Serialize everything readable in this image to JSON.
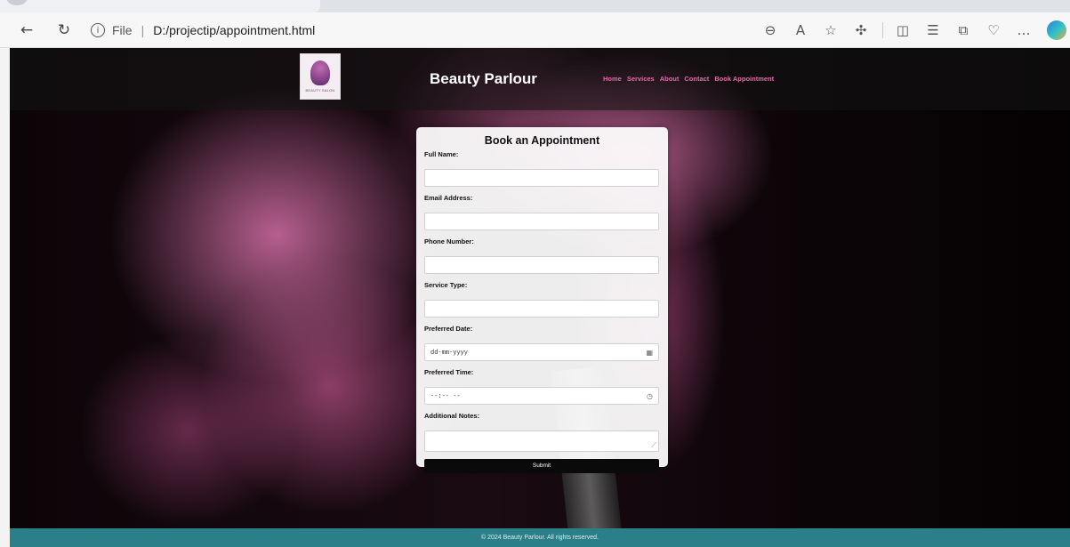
{
  "browser": {
    "address_protocol": "File",
    "address_url": "D:/projectip/appointment.html",
    "icons": [
      "back-icon",
      "refresh-icon",
      "zoom-icon",
      "read-aloud-icon",
      "favorite-icon",
      "extensions-icon",
      "split-screen-icon",
      "favorites-list-icon",
      "collections-icon",
      "health-icon",
      "more-icon",
      "copilot-icon"
    ]
  },
  "site": {
    "brand": "Beauty Parlour",
    "logo_text": "BEAUTY SALON",
    "nav": [
      "Home",
      "Services",
      "About",
      "Contact",
      "Book Appointment"
    ]
  },
  "form": {
    "title": "Book an Appointment",
    "labels": {
      "full_name": "Full Name:",
      "email": "Email Address:",
      "phone": "Phone Number:",
      "service": "Service Type:",
      "date": "Preferred Date:",
      "time": "Preferred Time:",
      "notes": "Additional Notes:"
    },
    "date_placeholder": "dd-mm-yyyy",
    "time_placeholder": "--:-- --",
    "submit": "Submit"
  },
  "footer": "© 2024 Beauty Parlour. All rights reserved.",
  "colors": {
    "nav_link": "#e36aa6",
    "footer_bg": "#2a7f88",
    "button_bg": "#0a0a0a"
  }
}
